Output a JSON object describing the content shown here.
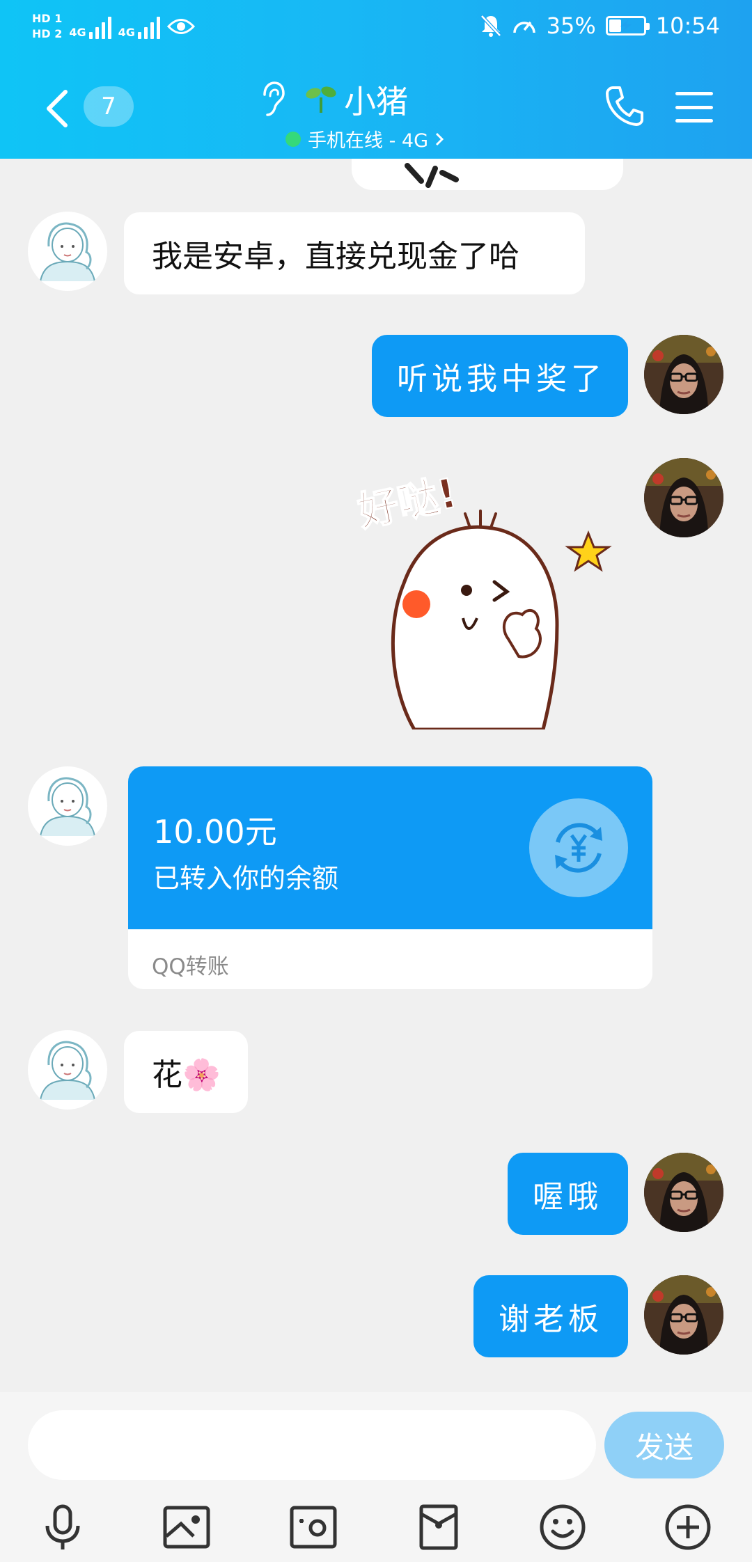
{
  "status_bar": {
    "network_type_1": "4G",
    "network_type_2": "4G",
    "battery_percent": "35%",
    "battery_level": 0.35,
    "time": "10:54"
  },
  "header": {
    "unread_count": "7",
    "contact_name": "小猪",
    "online_status": "手机在线 - 4G",
    "accent_color": "#18b8f5"
  },
  "messages": [
    {
      "side": "left",
      "type": "text",
      "text": "我是安卓，直接兑现金了哈"
    },
    {
      "side": "right",
      "type": "text",
      "text": "听说我中奖了"
    },
    {
      "side": "right",
      "type": "sticker",
      "text": "好哒!"
    },
    {
      "side": "left",
      "type": "transfer",
      "amount": "10.00元",
      "desc": "已转入你的余额",
      "footer": "QQ转账"
    },
    {
      "side": "left",
      "type": "text",
      "text": "花🌸"
    },
    {
      "side": "right",
      "type": "text",
      "text": "喔哦"
    },
    {
      "side": "right",
      "type": "text",
      "text": "谢老板"
    }
  ],
  "composer": {
    "input_value": "",
    "send_label": "发送"
  },
  "toolbar": {
    "icons": [
      "microphone-icon",
      "image-icon",
      "camera-icon",
      "red-packet-icon",
      "emoji-icon",
      "plus-icon"
    ]
  }
}
